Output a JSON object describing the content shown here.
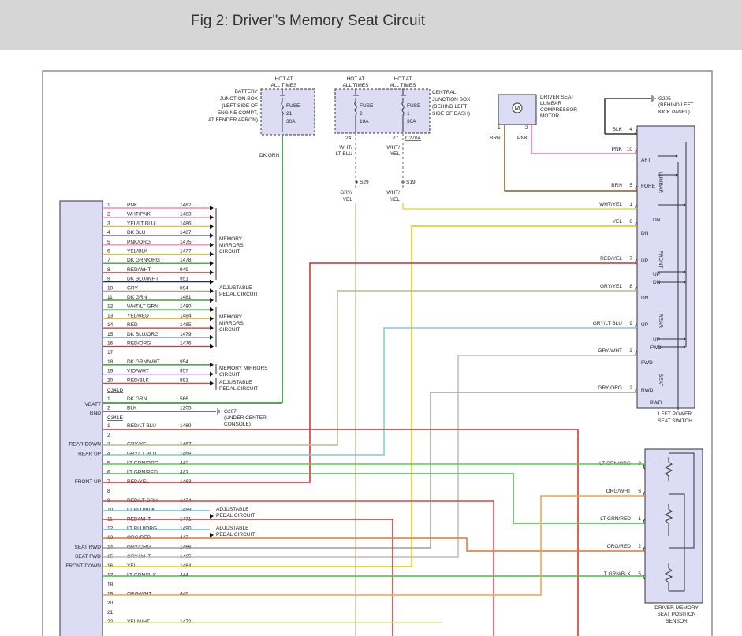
{
  "header": {
    "title": "Fig 2: Driver\"s Memory Seat Circuit"
  },
  "colors": {
    "header_bg": "#d6d6d6",
    "module_fill": "#dcdcf5",
    "pink": "#ff69b4",
    "green": "#1a8c1a",
    "brown": "#8b5a1e",
    "yellow": "#e0e040",
    "red": "#d42a2a",
    "blue": "#3030c8",
    "orange": "#f08020"
  },
  "top": {
    "battery_jb": {
      "hot": [
        "HOT AT",
        "ALL TIMES"
      ],
      "desc": [
        "BATTERY",
        "JUNCTION BOX",
        "(LEFT SIDE OF",
        "ENGINE COMPT,",
        "AT FENDER APRON)"
      ],
      "fuse": [
        "FUSE",
        "21",
        "30A"
      ]
    },
    "central_jb": {
      "hot1": [
        "HOT AT",
        "ALL TIMES"
      ],
      "hot2": [
        "HOT AT",
        "ALL TIMES"
      ],
      "desc": [
        "CENTRAL",
        "JUNCTION BOX",
        "(BEHIND LEFT",
        "SIDE OF DASH)"
      ],
      "fuse1": [
        "FUSE",
        "2",
        "10A"
      ],
      "fuse2": [
        "FUSE",
        "1",
        "30A"
      ],
      "pin1": "24",
      "pin2": "27",
      "connector": "C270A"
    },
    "wire_dkgrn": "DK GRN",
    "wht_ltblu": [
      "WHT/",
      "LT BLU"
    ],
    "wht_yel": [
      "WHT/",
      "YEL"
    ],
    "s29": "S29",
    "s19": "S19",
    "gry_yel": [
      "GRY/",
      "YEL"
    ],
    "wht_yel2": [
      "WHT/",
      "YEL"
    ],
    "motor": {
      "desc": [
        "DRIVER SEAT",
        "LUMBAR",
        "COMPRESSOR",
        "MOTOR"
      ],
      "symbol": "M",
      "pin1": "1",
      "pin2": "2",
      "wire1": "BRN",
      "wire2": "PNK"
    },
    "ground": {
      "id": "G205",
      "desc": [
        "(BEHIND LEFT",
        "KICK PANEL)"
      ]
    }
  },
  "left_module": {
    "connector1": "C341D",
    "connector2": "C341E",
    "rows1": [
      {
        "pin": "1",
        "color": "PNK",
        "circuit": "1482",
        "wc": "#ff69b4"
      },
      {
        "pin": "2",
        "color": "WHT/PNK",
        "circuit": "1483",
        "wc": "#ff9ad0"
      },
      {
        "pin": "3",
        "color": "YEL/LT BLU",
        "circuit": "1486",
        "wc": "#cccc30"
      },
      {
        "pin": "4",
        "color": "DK BLU",
        "circuit": "1487",
        "wc": "#2020a0"
      },
      {
        "pin": "5",
        "color": "PNK/ORG",
        "circuit": "1475",
        "wc": "#ff69b4"
      },
      {
        "pin": "6",
        "color": "YEL/BLK",
        "circuit": "1477",
        "wc": "#cccc30"
      },
      {
        "pin": "7",
        "color": "DK GRN/ORG",
        "circuit": "1478",
        "wc": "#1a8c1a"
      },
      {
        "pin": "8",
        "color": "RED/WHT",
        "circuit": "949",
        "wc": "#d42a2a"
      },
      {
        "pin": "9",
        "color": "DK BLU/WHT",
        "circuit": "951",
        "wc": "#2020a0"
      },
      {
        "pin": "10",
        "color": "GRY",
        "circuit": "894",
        "wc": "#999999"
      },
      {
        "pin": "11",
        "color": "DK GRN",
        "circuit": "1481",
        "wc": "#1a8c1a"
      },
      {
        "pin": "12",
        "color": "WHT/LT GRN",
        "circuit": "1480",
        "wc": "#60d060"
      },
      {
        "pin": "13",
        "color": "YEL/RED",
        "circuit": "1484",
        "wc": "#e0c030"
      },
      {
        "pin": "14",
        "color": "RED",
        "circuit": "1485",
        "wc": "#d42a2a"
      },
      {
        "pin": "15",
        "color": "DK BLU/ORG",
        "circuit": "1479",
        "wc": "#2020a0"
      },
      {
        "pin": "16",
        "color": "RED/ORG",
        "circuit": "1476",
        "wc": "#e03030"
      },
      {
        "pin": "17",
        "color": "",
        "circuit": "",
        "wc": ""
      },
      {
        "pin": "18",
        "color": "DK GRN/WHT",
        "circuit": "954",
        "wc": "#1a8c1a"
      },
      {
        "pin": "19",
        "color": "VIO/WHT",
        "circuit": "957",
        "wc": "#8040c0"
      },
      {
        "pin": "20",
        "color": "RED/BLK",
        "circuit": "891",
        "wc": "#d42a2a"
      }
    ],
    "vbatt": "VBATT",
    "gnd": "GND",
    "rows_power": [
      {
        "pin": "1",
        "color": "DK GRN",
        "circuit": "566"
      },
      {
        "pin": "2",
        "color": "BLK",
        "circuit": "1205"
      }
    ],
    "g207": [
      "G207",
      "(UNDER CENTER",
      "CONSOLE)"
    ],
    "rows2": [
      {
        "pin": "1",
        "color": "RED/LT BLU",
        "circuit": "1469",
        "side": ""
      },
      {
        "pin": "2",
        "color": "",
        "circuit": "",
        "side": ""
      },
      {
        "pin": "3",
        "color": "GRY/YEL",
        "circuit": "1467",
        "side": "REAR DOWN"
      },
      {
        "pin": "4",
        "color": "GRY/LT BLU",
        "circuit": "1468",
        "side": "REAR UP"
      },
      {
        "pin": "5",
        "color": "LT GRN/ORG",
        "circuit": "442",
        "side": ""
      },
      {
        "pin": "6",
        "color": "LT GRN/RED",
        "circuit": "443",
        "side": ""
      },
      {
        "pin": "7",
        "color": "RED/YEL",
        "circuit": "1463",
        "side": "FRONT UP"
      },
      {
        "pin": "8",
        "color": "",
        "circuit": "",
        "side": ""
      },
      {
        "pin": "9",
        "color": "RED/LT GRN",
        "circuit": "1474",
        "side": ""
      },
      {
        "pin": "10",
        "color": "LT BLU/BLK",
        "circuit": "1489",
        "side": ""
      },
      {
        "pin": "11",
        "color": "RED/WHT",
        "circuit": "1471",
        "side": ""
      },
      {
        "pin": "12",
        "color": "LT BLU/ORG",
        "circuit": "1490",
        "side": ""
      },
      {
        "pin": "13",
        "color": "ORG/RED",
        "circuit": "447",
        "side": ""
      },
      {
        "pin": "14",
        "color": "GRY/ORG",
        "circuit": "1466",
        "side": "SEAT RWD"
      },
      {
        "pin": "15",
        "color": "GRY/WHT",
        "circuit": "1465",
        "side": "SEAT FWD"
      },
      {
        "pin": "16",
        "color": "YEL",
        "circuit": "1464",
        "side": "FRONT DOWN"
      },
      {
        "pin": "17",
        "color": "LT GRN/BLK",
        "circuit": "444",
        "side": ""
      },
      {
        "pin": "18",
        "color": "",
        "circuit": "",
        "side": ""
      },
      {
        "pin": "19",
        "color": "ORG/WHT",
        "circuit": "446",
        "side": ""
      },
      {
        "pin": "20",
        "color": "",
        "circuit": "",
        "side": ""
      },
      {
        "pin": "21",
        "color": "",
        "circuit": "",
        "side": ""
      },
      {
        "pin": "22",
        "color": "YEL/WHT",
        "circuit": "1472",
        "side": ""
      }
    ],
    "group_labels": {
      "memory_mirrors": [
        "MEMORY",
        "MIRRORS",
        "CIRCUIT"
      ],
      "adj_pedal": [
        "ADJUSTABLE",
        "PEDAL CIRCUIT"
      ],
      "memory_mirrors2": [
        "MEMORY",
        "MIRRORS",
        "CIRCUIT"
      ],
      "memory_mirrors3": [
        "MEMORY MIRRORS",
        "CIRCUIT"
      ],
      "adj_pedal2": [
        "ADJUSTABLE",
        "PEDAL CIRCUIT"
      ],
      "adj_pedal3": [
        "ADJUSTABLE",
        "PEDAL CIRCUIT"
      ],
      "adj_pedal4": [
        "ADJUSTABLE",
        "PEDAL CIRCUIT"
      ]
    }
  },
  "switch": {
    "title": [
      "LEFT POWER",
      "SEAT SWITCH"
    ],
    "wires": [
      {
        "label": "BLK",
        "pin": "4"
      },
      {
        "label": "PNK",
        "pin": "10"
      },
      {
        "label": "BRN",
        "pin": "5"
      },
      {
        "label": "WHT/YEL",
        "pin": "1"
      },
      {
        "label": "YEL",
        "pin": "6"
      },
      {
        "label": "RED/YEL",
        "pin": "7"
      },
      {
        "label": "GRY/YEL",
        "pin": "8"
      },
      {
        "label": "GRY/LT BLU",
        "pin": "9"
      },
      {
        "label": "GRY/WHT",
        "pin": "3"
      },
      {
        "label": "GRY/ORG",
        "pin": "2"
      }
    ],
    "pos": [
      "AFT",
      "FORE",
      "DN",
      "DN",
      "UP",
      "UP",
      "DN",
      "DN",
      "UP",
      "UP",
      "FWD",
      "FWD",
      "RWD",
      "RWD"
    ],
    "sections": [
      "LUMBAR",
      "FRONT",
      "REAR",
      "SEAT"
    ]
  },
  "sensor": {
    "title": [
      "DRIVER MEMORY",
      "SEAT POSITION",
      "SENSOR"
    ],
    "wires": [
      {
        "label": "LT GRN/ORG",
        "pin": "3"
      },
      {
        "label": "ORG/WHT",
        "pin": "6"
      },
      {
        "label": "LT GRN/RED",
        "pin": "1"
      },
      {
        "label": "ORG/RED",
        "pin": "2"
      },
      {
        "label": "LT GRN/BLK",
        "pin": "5"
      }
    ]
  }
}
